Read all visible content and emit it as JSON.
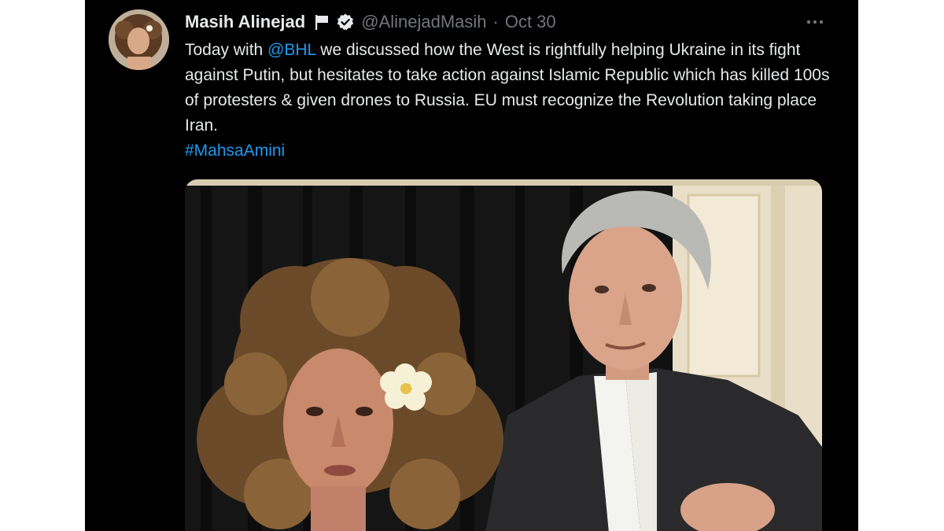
{
  "tweet": {
    "author_name": "Masih Alinejad",
    "handle": "@AlinejadMasih",
    "separator": "·",
    "date": "Oct 30",
    "text_before_mention": "Today with ",
    "mention": "@BHL",
    "text_after_mention": " we discussed how the West is rightfully helping Ukraine in its fight against Putin, but hesitates to take action against Islamic Republic which has killed 100s of protesters & given drones to Russia. EU must recognize the Revolution taking place Iran.",
    "hashtag": "#MahsaAmini"
  },
  "icons": {
    "flag": "white-flag-icon",
    "verified": "verified-badge-icon",
    "more": "more-options-icon"
  },
  "colors": {
    "background": "#000000",
    "text": "#e7e9ea",
    "muted": "#71767b",
    "link": "#1d9bf0"
  }
}
